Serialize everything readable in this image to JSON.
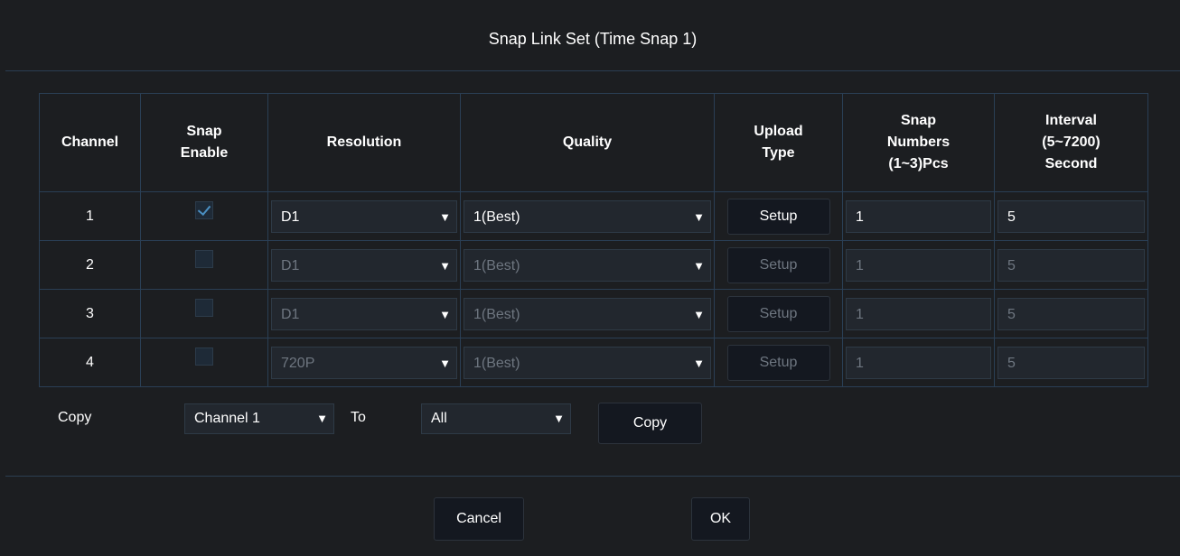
{
  "title": "Snap Link Set (Time Snap 1)",
  "columns": {
    "channel": "Channel",
    "snap_enable": [
      "Snap",
      "Enable"
    ],
    "resolution": "Resolution",
    "quality": "Quality",
    "upload_type": [
      "Upload",
      "Type"
    ],
    "snap_numbers": [
      "Snap",
      "Numbers",
      "(1~3)Pcs"
    ],
    "interval": [
      "Interval",
      "(5~7200)",
      "Second"
    ]
  },
  "rows": [
    {
      "channel": "1",
      "snap_enable": true,
      "resolution": "D1",
      "quality": "1(Best)",
      "upload": "Setup",
      "snap_numbers": "1",
      "interval": "5",
      "enabled": true
    },
    {
      "channel": "2",
      "snap_enable": false,
      "resolution": "D1",
      "quality": "1(Best)",
      "upload": "Setup",
      "snap_numbers": "1",
      "interval": "5",
      "enabled": false
    },
    {
      "channel": "3",
      "snap_enable": false,
      "resolution": "D1",
      "quality": "1(Best)",
      "upload": "Setup",
      "snap_numbers": "1",
      "interval": "5",
      "enabled": false
    },
    {
      "channel": "4",
      "snap_enable": false,
      "resolution": "720P",
      "quality": "1(Best)",
      "upload": "Setup",
      "snap_numbers": "1",
      "interval": "5",
      "enabled": false
    }
  ],
  "copy": {
    "label": "Copy",
    "from_value": "Channel 1",
    "to_label": "To",
    "to_value": "All",
    "button": "Copy"
  },
  "footer": {
    "cancel": "Cancel",
    "ok": "OK"
  },
  "icons": {
    "dropdown": "▼"
  }
}
